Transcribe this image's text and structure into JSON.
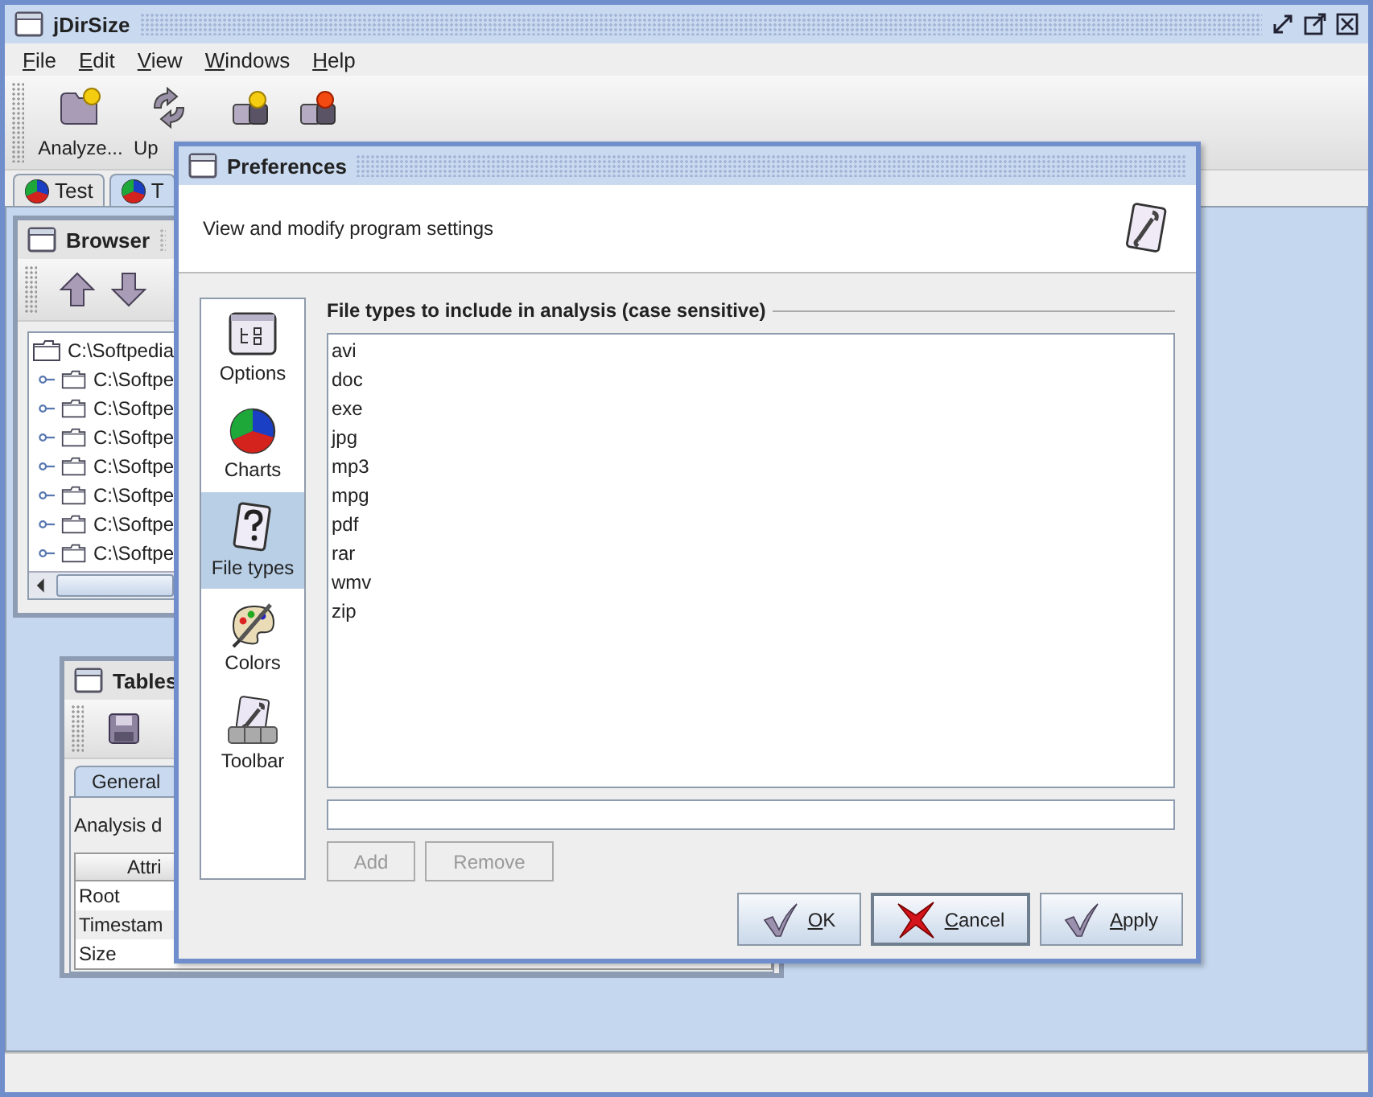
{
  "window": {
    "title": "jDirSize"
  },
  "menu": [
    {
      "key": "F",
      "rest": "ile"
    },
    {
      "key": "E",
      "rest": "dit"
    },
    {
      "key": "V",
      "rest": "iew"
    },
    {
      "key": "W",
      "rest": "indows"
    },
    {
      "key": "H",
      "rest": "elp"
    }
  ],
  "toolbar": [
    {
      "kind": "analyze",
      "label": "Analyze..."
    },
    {
      "kind": "update",
      "label": "Up"
    },
    {
      "kind": "start"
    },
    {
      "kind": "stop"
    }
  ],
  "tabs": [
    {
      "label": "Test",
      "selected": false
    },
    {
      "label": "T",
      "selected": true
    }
  ],
  "browser": {
    "title": "Browser",
    "tree": {
      "label": "C:\\Softpedia",
      "children": [
        {
          "label": "C:\\Softpe",
          "expanded": false
        },
        {
          "label": "C:\\Softpe",
          "expanded": false
        },
        {
          "label": "C:\\Softpe",
          "expanded": false
        },
        {
          "label": "C:\\Softpe",
          "expanded": false
        },
        {
          "label": "C:\\Softpe",
          "expanded": false
        },
        {
          "label": "C:\\Softpe",
          "expanded": false
        },
        {
          "label": "C:\\Softpe",
          "expanded": false
        }
      ]
    }
  },
  "tables": {
    "title": "Tables",
    "tabs": [
      {
        "label": "General",
        "selected": true
      }
    ],
    "caption": "Analysis d",
    "columns": [
      "Attri"
    ],
    "rows": [
      "Root",
      "Timestam",
      "Size"
    ]
  },
  "preferences": {
    "title": "Preferences",
    "description": "View and modify program settings",
    "categories": [
      {
        "kind": "options",
        "label": "Options",
        "selected": false
      },
      {
        "kind": "charts",
        "label": "Charts",
        "selected": false
      },
      {
        "kind": "filetypes",
        "label": "File types",
        "selected": true
      },
      {
        "kind": "colors",
        "label": "Colors",
        "selected": false
      },
      {
        "kind": "toolbar",
        "label": "Toolbar",
        "selected": false
      }
    ],
    "section_title": "File types to include in analysis (case sensitive)",
    "file_types": [
      "avi",
      "doc",
      "exe",
      "jpg",
      "mp3",
      "mpg",
      "pdf",
      "rar",
      "wmv",
      "zip"
    ],
    "list_buttons": [
      {
        "label": "Add",
        "disabled": true
      },
      {
        "label": "Remove",
        "disabled": true
      }
    ],
    "buttons": [
      {
        "kind": "ok",
        "key": "O",
        "rest": "K",
        "focused": false
      },
      {
        "kind": "cancel",
        "key": "C",
        "rest": "ancel",
        "focused": true
      },
      {
        "kind": "apply",
        "key": "A",
        "rest": "pply",
        "focused": false
      }
    ]
  }
}
